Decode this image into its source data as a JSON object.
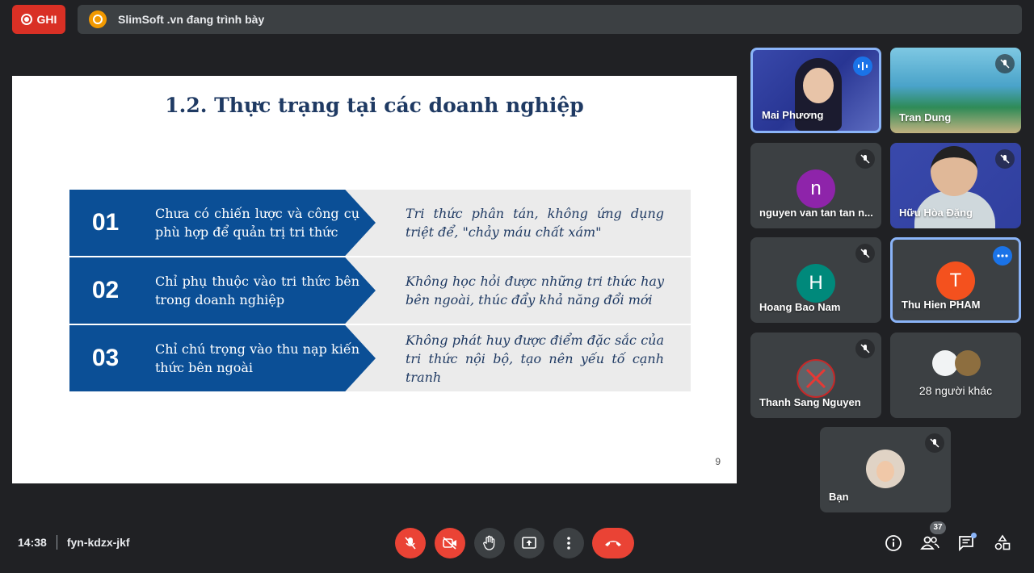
{
  "top_bar": {
    "record_label": "GHI",
    "presenting_text": "SlimSoft .vn đang trình bày"
  },
  "slide": {
    "title": "1.2. Thực trạng tại các doanh nghiệp",
    "rows": [
      {
        "num": "01",
        "left": "Chưa có chiến lược và công cụ phù hợp để quản trị tri thức",
        "right": "Tri thức phân tán, không ứng dụng triệt để, \"chảy máu chất xám\""
      },
      {
        "num": "02",
        "left": "Chỉ phụ thuộc vào tri thức bên trong doanh nghiệp",
        "right": "Không học hỏi được những tri thức hay bên ngoài, thúc đẩy khả năng đổi mới"
      },
      {
        "num": "03",
        "left": "Chỉ chú trọng vào thu nạp kiến thức bên ngoài",
        "right": "Không phát huy được điểm đặc sắc của tri thức nội bộ, tạo nên yếu tố cạnh tranh"
      }
    ],
    "page_number": "9"
  },
  "participants": [
    {
      "name": "Mai Phương"
    },
    {
      "name": "Tran Dung"
    },
    {
      "name": "nguyen van tan tan n...",
      "initial": "n",
      "color": "#8e24aa"
    },
    {
      "name": "Hữu Hòa Đặng"
    },
    {
      "name": "Hoang Bao Nam",
      "initial": "H",
      "color": "#00897b"
    },
    {
      "name": "Thu Hien PHAM",
      "initial": "T",
      "color": "#f4511e"
    },
    {
      "name": "Thanh Sang Nguyen"
    },
    {
      "name": "28 người khác"
    },
    {
      "name": "Bạn"
    }
  ],
  "bottom_bar": {
    "time": "14:38",
    "meeting_code": "fyn-kdzx-jkf",
    "people_count": "37"
  },
  "colors": {
    "background": "#202124",
    "danger": "#ea4335",
    "slide_blue": "#0b4f96",
    "active_border": "#8ab4f8"
  }
}
